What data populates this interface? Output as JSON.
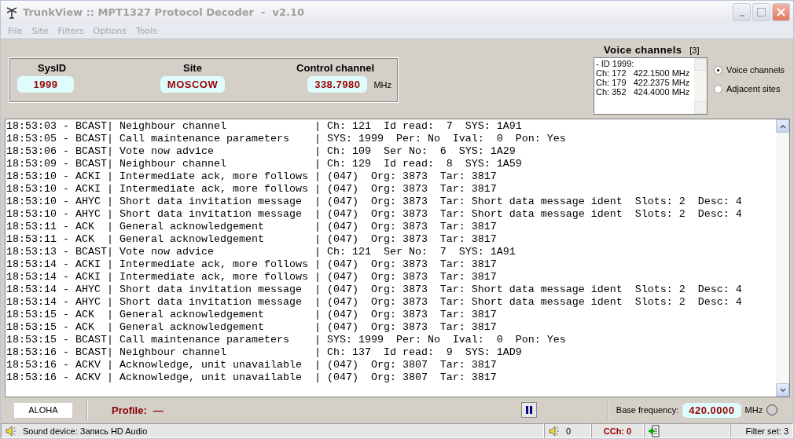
{
  "window": {
    "title": "TrunkView :: MPT1327 Protocol Decoder  -  v2.10"
  },
  "menu": [
    "File",
    "Site",
    "Filters",
    "Options",
    "Tools"
  ],
  "info_panel": {
    "fields": [
      {
        "label": "SysID",
        "value": "1999"
      },
      {
        "label": "Site",
        "value": "MOSCOW"
      },
      {
        "label": "Control channel",
        "value": "338.7980",
        "unit": "MHz"
      }
    ]
  },
  "voice_channels": {
    "title": "Voice channels",
    "count": "[3]",
    "lines": [
      "- ID 1999:",
      "Ch: 172   422.1500 MHz",
      "Ch: 179   422.2375 MHz",
      "Ch: 352   424.4000 MHz"
    ],
    "options": [
      {
        "label": "Voice channels",
        "selected": true
      },
      {
        "label": "Adjacent sites",
        "selected": false
      }
    ]
  },
  "log": {
    "lines": [
      "18:53:03 - BCAST| Neighbour channel              | Ch: 121  Id read:  7  SYS: 1A91",
      "18:53:05 - BCAST| Call maintenance parameters    | SYS: 1999  Per: No  Ival:  0  Pon: Yes",
      "18:53:06 - BCAST| Vote now advice                | Ch: 109  Ser No:  6  SYS: 1A29",
      "18:53:09 - BCAST| Neighbour channel              | Ch: 129  Id read:  8  SYS: 1A59",
      "18:53:10 - ACKI | Intermediate ack, more follows | (047)  Org: 3873  Tar: 3817",
      "18:53:10 - ACKI | Intermediate ack, more follows | (047)  Org: 3873  Tar: 3817",
      "18:53:10 - AHYC | Short data invitation message  | (047)  Org: 3873  Tar: Short data message ident  Slots: 2  Desc: 4",
      "18:53:10 - AHYC | Short data invitation message  | (047)  Org: 3873  Tar: Short data message ident  Slots: 2  Desc: 4",
      "18:53:11 - ACK  | General acknowledgement        | (047)  Org: 3873  Tar: 3817",
      "18:53:11 - ACK  | General acknowledgement        | (047)  Org: 3873  Tar: 3817",
      "18:53:13 - BCAST| Vote now advice                | Ch: 121  Ser No:  7  SYS: 1A91",
      "18:53:14 - ACKI | Intermediate ack, more follows | (047)  Org: 3873  Tar: 3817",
      "18:53:14 - ACKI | Intermediate ack, more follows | (047)  Org: 3873  Tar: 3817",
      "18:53:14 - AHYC | Short data invitation message  | (047)  Org: 3873  Tar: Short data message ident  Slots: 2  Desc: 4",
      "18:53:14 - AHYC | Short data invitation message  | (047)  Org: 3873  Tar: Short data message ident  Slots: 2  Desc: 4",
      "18:53:15 - ACK  | General acknowledgement        | (047)  Org: 3873  Tar: 3817",
      "18:53:15 - ACK  | General acknowledgement        | (047)  Org: 3873  Tar: 3817",
      "18:53:15 - BCAST| Call maintenance parameters    | SYS: 1999  Per: No  Ival:  0  Pon: Yes",
      "18:53:16 - BCAST| Neighbour channel              | Ch: 137  Id read:  9  SYS: 1AD9",
      "18:53:16 - ACKV | Acknowledge, unit unavailable  | (047)  Org: 3807  Tar: 3817",
      "18:53:16 - ACKV | Acknowledge, unit unavailable  | (047)  Org: 3807  Tar: 3817"
    ]
  },
  "control_bar": {
    "mode": "ALOHA",
    "profile_label": "Profile:",
    "profile_value": "—",
    "base_frequency": {
      "label": "Base frequency:",
      "value": "420.0000",
      "unit": "MHz"
    }
  },
  "status_bar": {
    "sound_device": "Sound device: Запись HD Audio",
    "volume": "0",
    "cch": "CCh: 0",
    "filter_set": "Filter set: 3"
  }
}
